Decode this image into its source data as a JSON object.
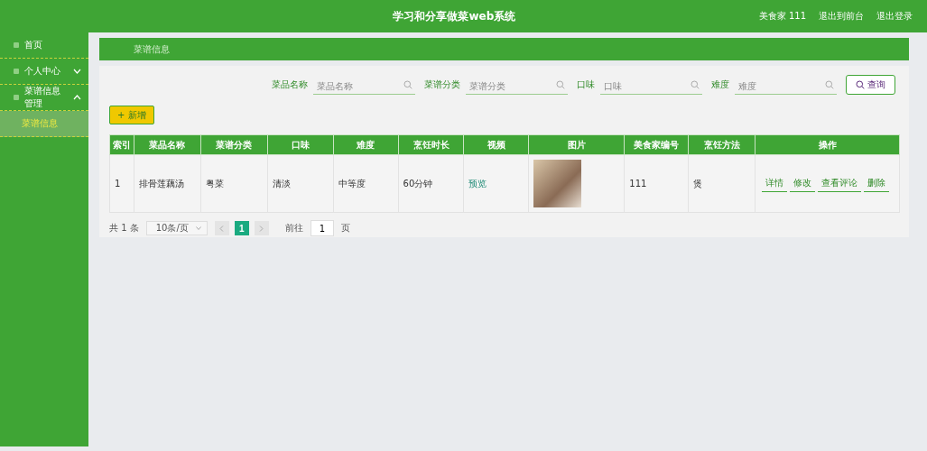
{
  "header": {
    "title": "学习和分享做菜web系统",
    "user": "美食家 111",
    "links": [
      "退出到前台",
      "退出登录"
    ]
  },
  "sidebar": {
    "items": [
      {
        "label": "首页"
      },
      {
        "label": "个人中心",
        "expanded": false
      },
      {
        "label": "菜谱信息管理",
        "expanded": true,
        "children": [
          {
            "label": "菜谱信息",
            "selected": true
          }
        ]
      }
    ]
  },
  "breadcrumb": "菜谱信息",
  "filters": [
    {
      "label": "菜品名称",
      "placeholder": "菜品名称"
    },
    {
      "label": "菜谱分类",
      "placeholder": "菜谱分类"
    },
    {
      "label": "口味",
      "placeholder": "口味"
    },
    {
      "label": "难度",
      "placeholder": "难度"
    }
  ],
  "search_button": "查询",
  "add_button": "+ 新增",
  "table": {
    "columns": [
      "索引",
      "菜品名称",
      "菜谱分类",
      "口味",
      "难度",
      "烹饪时长",
      "视频",
      "图片",
      "美食家编号",
      "烹饪方法",
      "操作"
    ],
    "rows": [
      {
        "index": "1",
        "name": "排骨莲藕汤",
        "category": "粤菜",
        "taste": "清淡",
        "difficulty": "中等度",
        "duration": "60分钟",
        "video": "预览",
        "chef_no": "111",
        "method": "煲",
        "actions": [
          "详情",
          "修改",
          "查看评论",
          "删除"
        ]
      }
    ]
  },
  "pagination": {
    "total": "共 1 条",
    "page_size": "10条/页",
    "pages": [
      {
        "label": "1",
        "selected": true
      }
    ],
    "goto_label": "前往",
    "goto_value": "1",
    "page_unit": "页"
  }
}
